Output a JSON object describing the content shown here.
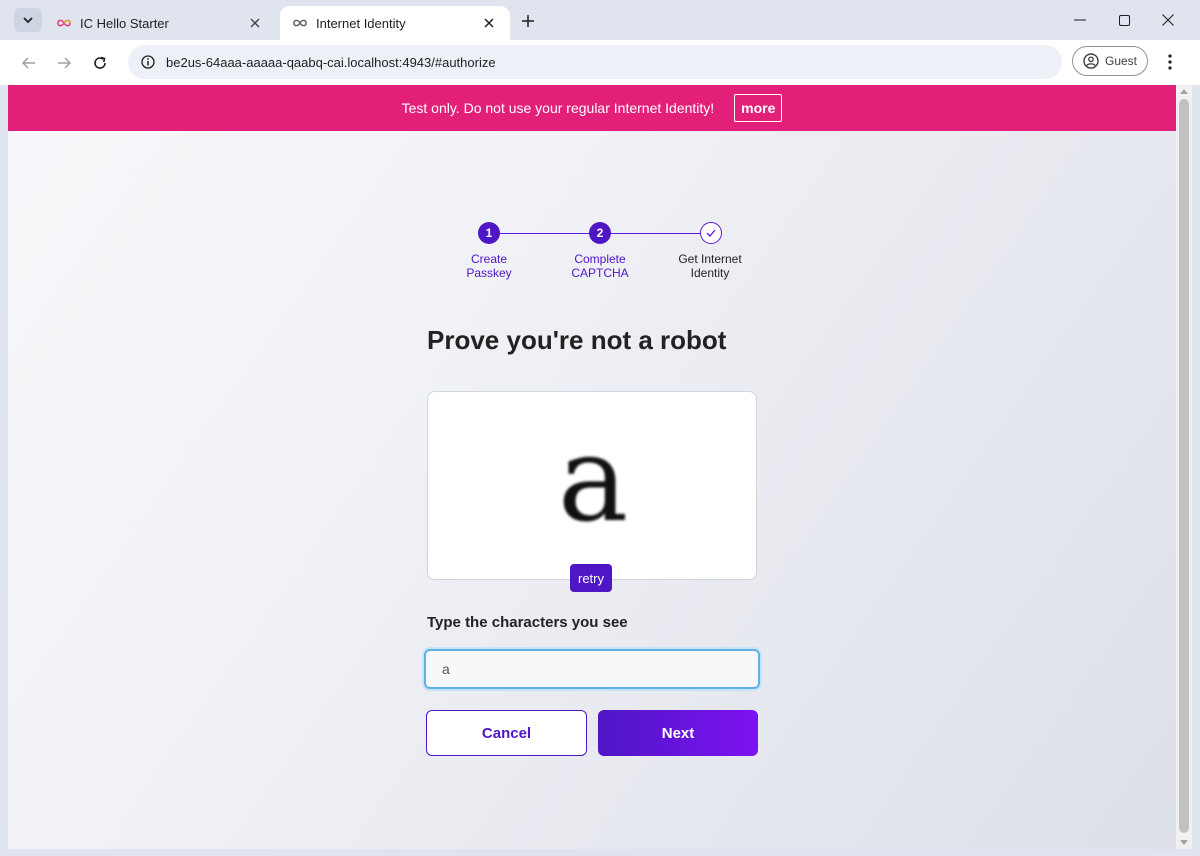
{
  "browser": {
    "tabs": [
      {
        "title": "IC Hello Starter",
        "active": false
      },
      {
        "title": "Internet Identity",
        "active": true
      }
    ],
    "url": "be2us-64aaa-aaaaa-qaabq-cai.localhost:4943/#authorize",
    "profile_label": "Guest"
  },
  "banner": {
    "text": "Test only. Do not use your regular Internet Identity!",
    "more_label": "more",
    "color": "#e2207a"
  },
  "stepper": {
    "steps": [
      {
        "number": "1",
        "label": "Create\nPasskey",
        "status": "done"
      },
      {
        "number": "2",
        "label": "Complete\nCAPTCHA",
        "status": "current"
      },
      {
        "number": "",
        "label": "Get Internet\nIdentity",
        "status": "pending"
      }
    ]
  },
  "main": {
    "heading": "Prove you're not a robot",
    "captcha_text": "a",
    "retry_label": "retry",
    "input_label": "Type the characters you see",
    "input_value": "a",
    "cancel_label": "Cancel",
    "next_label": "Next"
  },
  "colors": {
    "accent": "#4f16c6",
    "accent_gradient_end": "#7d12f0",
    "input_focus": "#5fb2e4"
  }
}
